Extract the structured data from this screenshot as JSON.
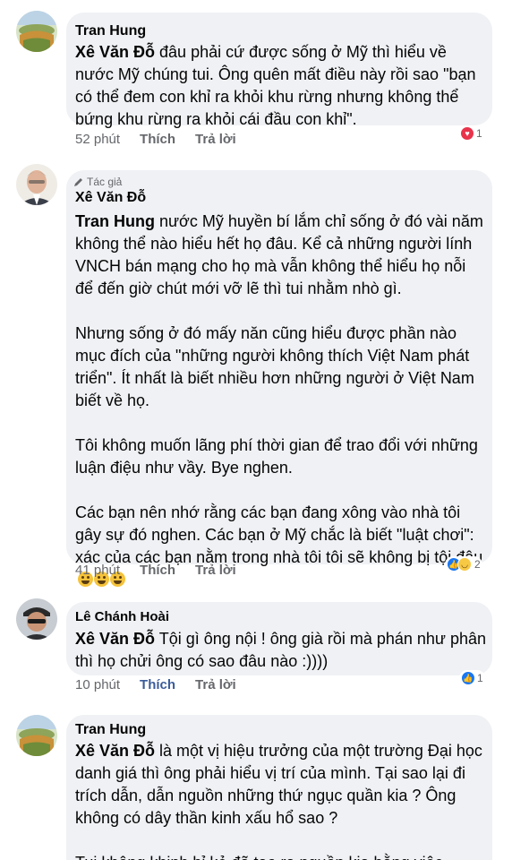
{
  "comments": [
    {
      "name": "Tran Hung",
      "mention": "Xê Văn Đỗ",
      "text": " đâu phải cứ được sống ở Mỹ thì hiểu về nước Mỹ chúng tui. Ông quên mất điều này rồi sao \"bạn có thể đem con khỉ ra khỏi khu rừng nhưng không thể bứng khu rừng ra khỏi cái đầu con khỉ\".",
      "time": "52 phút",
      "like_label": "Thích",
      "reply_label": "Trả lời",
      "reaction_count": "1",
      "reaction_icons": [
        "love-icon"
      ]
    },
    {
      "badge": "Tác giả",
      "name": "Xê Văn Đỗ",
      "mention": "Tran Hung",
      "text": " nước Mỹ huyền bí lắm chỉ sống ở đó vài năm không thể nào hiểu hết họ đâu. Kể cả những người lính VNCH bán mạng cho họ mà vẫn không thể hiểu họ nỗi để đến giờ chút mới vỡ lẽ thì tui nhằm nhò gì.\n\nNhưng sống ở đó mấy năn cũng hiểu được phần nào mục đích của \"những người không thích Việt Nam phát triển\". Ít nhất là biết nhiều hơn những người ở Việt Nam biết về họ.\n\nTôi không muốn lãng phí thời gian để trao đổi với những luận điệu như vầy. Bye nghen.\n\nCác bạn nên nhớ rằng các bạn đang xông vào nhà tôi gây sự đó nghen. Các bạn ở Mỹ chắc là biết \"luật chơi\": xác của các bạn nằm trong nhà tôi tôi sẽ không bị tội đâu",
      "time": "41 phút",
      "like_label": "Thích",
      "reply_label": "Trả lời",
      "reaction_count": "2",
      "reaction_icons": [
        "like-icon",
        "haha-icon"
      ]
    },
    {
      "name": "Lê Chánh Hoài",
      "mention": "Xê Văn Đỗ",
      "text": " Tội gì ông nội ! ông già rồi mà phán như phân thì họ chửi ông có sao đâu nào :))))",
      "time": "10 phút",
      "like_label": "Thích",
      "reply_label": "Trả lời",
      "reaction_count": "1",
      "reaction_icons": [
        "like-icon"
      ]
    },
    {
      "name": "Tran Hung",
      "mention": "Xê Văn Đỗ",
      "text": " là một vị hiệu trưởng của một trường Đại học danh giá thì ông phải hiểu vị trí của mình. Tại sao lại đi trích dẫn, dẫn nguồn những thứ ngục quần kia ? Ông không có dây thần kinh xấu hổ sao ?\n\nTui không khinh bỉ kẻ đã tạo ra nguồn kia bằng việc"
    }
  ],
  "colors": {
    "bubble": "#eff1f4",
    "meta_text": "#65676b",
    "like_active": "#3b5d9a",
    "like_reaction": "#1877f2",
    "love_reaction": "#e8334b",
    "haha_reaction": "#f7c843"
  }
}
